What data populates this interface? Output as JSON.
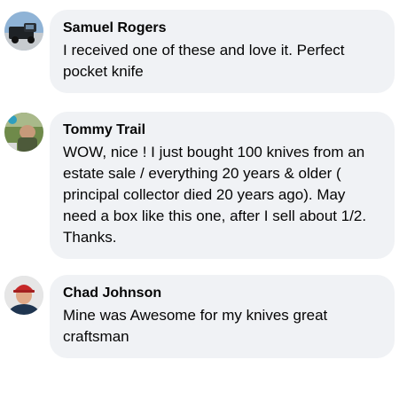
{
  "comments": [
    {
      "author": "Samuel Rogers",
      "text": "I received one of these and love it. Perfect pocket knife",
      "avatar_icon": "avatar-truck-photo"
    },
    {
      "author": "Tommy Trail",
      "text": "WOW, nice ! I just bought 100 knives from an estate sale / everything 20 years & older ( principal collector died 20 years ago). May need a box like this one, after I sell about 1/2. Thanks.",
      "avatar_icon": "avatar-outdoor-photo"
    },
    {
      "author": "Chad Johnson",
      "text": "Mine was Awesome for my knives great craftsman",
      "avatar_icon": "avatar-person-red-cap"
    }
  ],
  "colors": {
    "bubble_background": "#f0f2f5",
    "text": "#050505",
    "page_background": "#ffffff"
  }
}
